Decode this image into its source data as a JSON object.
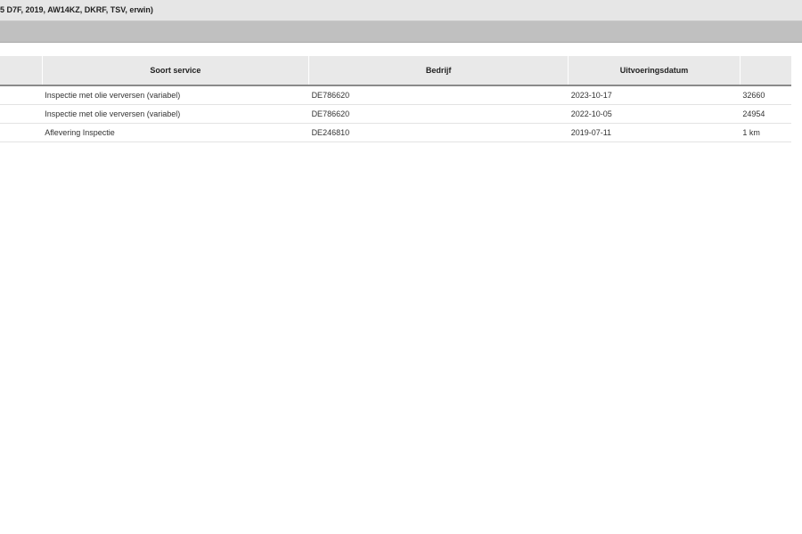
{
  "window": {
    "title": "5 D7F, 2019, AW14KZ, DKRF, TSV, erwin)"
  },
  "table": {
    "headers": [
      "",
      "Soort service",
      "Bedrijf",
      "Uitvoeringsdatum",
      ""
    ],
    "rows": [
      {
        "index": "",
        "service": "Inspectie met olie verversen (variabel)",
        "company": "DE786620",
        "date": "2023-10-17",
        "mileage": "32660"
      },
      {
        "index": "",
        "service": "Inspectie met olie verversen (variabel)",
        "company": "DE786620",
        "date": "2022-10-05",
        "mileage": "24954"
      },
      {
        "index": "",
        "service": "Aflevering Inspectie",
        "company": "DE246810",
        "date": "2019-07-11",
        "mileage": "1 km"
      }
    ]
  }
}
